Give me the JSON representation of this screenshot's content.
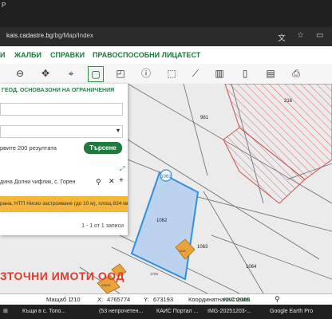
{
  "browser": {
    "title_fragment": "P",
    "url_domain": "kais.cadastre.bg",
    "url_path": "/bg/Map/Index"
  },
  "nav": {
    "items": [
      "И",
      "ЖАЛБИ",
      "СПРАВКИ",
      "ПРАВОСПОСОБНИ ЛИЦА",
      "ТЕСТ"
    ]
  },
  "panel": {
    "tabs": [
      "ГЕОД. ОСНОВА",
      "ЗОНИ НА ОГРАНИЧЕНИЯ"
    ],
    "limit_text": "рвите 200 резултата",
    "search_button": "Търсене",
    "result_search_text": "дина Долни чифлик, с. Горен",
    "result_row": "рана, НТП Ниско застрояване (до 10 м), площ 834 кв. м,",
    "paging": "1 - 1 от 1 записи"
  },
  "map": {
    "parcel_labels": [
      "216",
      "981",
      "1061",
      "1062",
      "1063",
      "1064",
      "1700"
    ],
    "building_labels": [
      "3СБ",
      "1ЖСБ"
    ],
    "watermark": "ЗТОЧНИ ИМОТИ ООД",
    "colors": {
      "selected_fill": "#bcd3ef",
      "selected_stroke": "#2f8fe0",
      "building": "#e8a43a",
      "hatch": "#e06565"
    }
  },
  "status": {
    "scale_label": "Мащаб 1:",
    "scale_value": "710",
    "x_label": "X:",
    "x_value": "4765774",
    "y_label": "Y:",
    "y_value": "673193",
    "crs_label": "Координатна система:",
    "crs_value": "ККС 2005"
  },
  "taskbar": {
    "items": [
      "Къщи в с. Топо...",
      "(53 непрочетен...",
      "КАИС Портал ...",
      "IMG-20251203-...",
      "Google Earth Pro"
    ]
  }
}
